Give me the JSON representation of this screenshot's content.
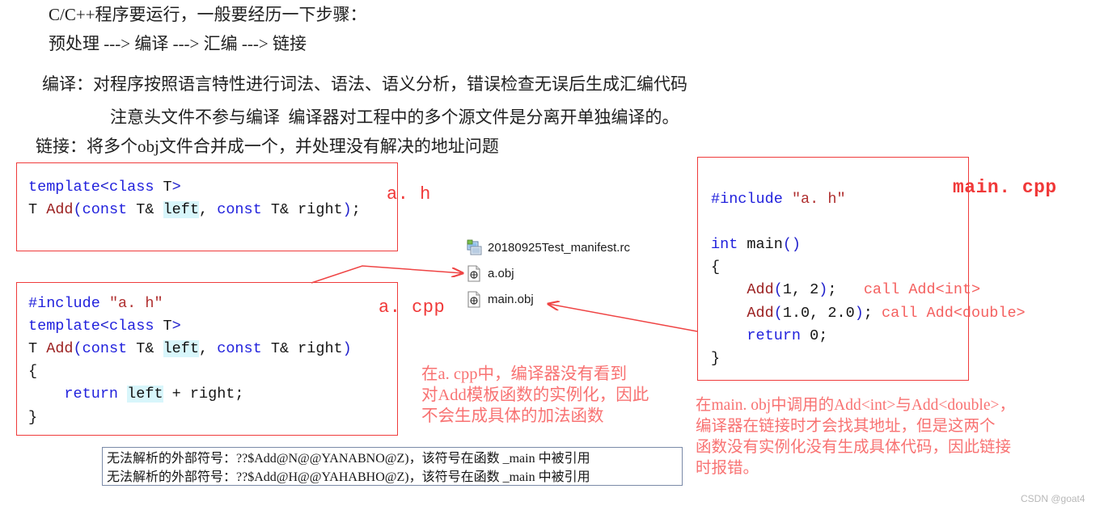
{
  "colors": {
    "box_border_red": "#ef3b3b",
    "annotation_red": "#f87272",
    "label_red": "#f03838",
    "keyword_blue": "#2222dd",
    "function_darkred": "#9b2020",
    "string_red": "#b03030",
    "highlight_cyan": "#d8f6fb",
    "error_box_border": "#7a8aa8",
    "background": "#ffffff"
  },
  "intro": {
    "line1": "C/C++程序要运行，一般要经历一下步骤：",
    "line2": "预处理 ---> 编译 ---> 汇编 ---> 链接",
    "line3": "编译：对程序按照语言特性进行词法、语法、语义分析，错误检查无误后生成汇编代码",
    "line4": "注意头文件不参与编译  编译器对工程中的多个源文件是分离开单独编译的。",
    "line5": "链接：将多个obj文件合并成一个，并处理没有解决的地址问题"
  },
  "boxes": {
    "a_h": {
      "label": "a. h",
      "lines": [
        [
          {
            "t": "template",
            "c": "kw"
          },
          {
            "t": "<",
            "c": "punc"
          },
          {
            "t": "class",
            "c": "kw"
          },
          {
            "t": " T",
            "c": "plain"
          },
          {
            "t": ">",
            "c": "punc"
          }
        ],
        [
          {
            "t": "T ",
            "c": "plain"
          },
          {
            "t": "Add",
            "c": "fn"
          },
          {
            "t": "(",
            "c": "punc"
          },
          {
            "t": "const",
            "c": "kw"
          },
          {
            "t": " T& ",
            "c": "plain"
          },
          {
            "t": "left",
            "c": "hl"
          },
          {
            "t": ", ",
            "c": "plain"
          },
          {
            "t": "const",
            "c": "kw"
          },
          {
            "t": " T& right",
            "c": "plain"
          },
          {
            "t": ")",
            "c": "punc"
          },
          {
            "t": ";",
            "c": "plain"
          }
        ]
      ]
    },
    "a_cpp": {
      "label": "a. cpp",
      "lines": [
        [
          {
            "t": "#include",
            "c": "kw"
          },
          {
            "t": " ",
            "c": "plain"
          },
          {
            "t": "\"a. h\"",
            "c": "str"
          }
        ],
        [
          {
            "t": "template",
            "c": "kw"
          },
          {
            "t": "<",
            "c": "punc"
          },
          {
            "t": "class",
            "c": "kw"
          },
          {
            "t": " T",
            "c": "plain"
          },
          {
            "t": ">",
            "c": "punc"
          }
        ],
        [
          {
            "t": "T ",
            "c": "plain"
          },
          {
            "t": "Add",
            "c": "fn"
          },
          {
            "t": "(",
            "c": "punc"
          },
          {
            "t": "const",
            "c": "kw"
          },
          {
            "t": " T& ",
            "c": "plain"
          },
          {
            "t": "left",
            "c": "hl"
          },
          {
            "t": ", ",
            "c": "plain"
          },
          {
            "t": "const",
            "c": "kw"
          },
          {
            "t": " T& right",
            "c": "plain"
          },
          {
            "t": ")",
            "c": "punc"
          }
        ],
        [
          {
            "t": "{",
            "c": "plain"
          }
        ],
        [
          {
            "t": "    ",
            "c": "plain"
          },
          {
            "t": "return",
            "c": "kw"
          },
          {
            "t": " ",
            "c": "plain"
          },
          {
            "t": "left",
            "c": "hl"
          },
          {
            "t": " + right;",
            "c": "plain"
          }
        ],
        [
          {
            "t": "}",
            "c": "plain"
          }
        ]
      ]
    },
    "main_cpp": {
      "label": "main. cpp",
      "lines": [
        [
          {
            "t": "#include",
            "c": "kw"
          },
          {
            "t": " ",
            "c": "plain"
          },
          {
            "t": "\"a. h\"",
            "c": "str"
          }
        ],
        [],
        [
          {
            "t": "int",
            "c": "kw"
          },
          {
            "t": " main",
            "c": "plain"
          },
          {
            "t": "()",
            "c": "punc"
          }
        ],
        [
          {
            "t": "{",
            "c": "plain"
          }
        ],
        [
          {
            "t": "    ",
            "c": "plain"
          },
          {
            "t": "Add",
            "c": "fn"
          },
          {
            "t": "(",
            "c": "punc"
          },
          {
            "t": "1",
            "c": "num"
          },
          {
            "t": ", ",
            "c": "plain"
          },
          {
            "t": "2",
            "c": "num"
          },
          {
            "t": ")",
            "c": "punc"
          },
          {
            "t": ";   ",
            "c": "plain"
          },
          {
            "t": "call Add<int>",
            "c": "cmt"
          }
        ],
        [
          {
            "t": "    ",
            "c": "plain"
          },
          {
            "t": "Add",
            "c": "fn"
          },
          {
            "t": "(",
            "c": "punc"
          },
          {
            "t": "1.0",
            "c": "num"
          },
          {
            "t": ", ",
            "c": "plain"
          },
          {
            "t": "2.0",
            "c": "num"
          },
          {
            "t": ")",
            "c": "punc"
          },
          {
            "t": "; ",
            "c": "plain"
          },
          {
            "t": "call Add<double>",
            "c": "cmt"
          }
        ],
        [
          {
            "t": "    ",
            "c": "plain"
          },
          {
            "t": "return",
            "c": "kw"
          },
          {
            "t": " ",
            "c": "plain"
          },
          {
            "t": "0",
            "c": "num"
          },
          {
            "t": ";",
            "c": "plain"
          }
        ],
        [
          {
            "t": "}",
            "c": "plain"
          }
        ]
      ]
    }
  },
  "filelist": [
    {
      "icon": "manifest-resource-icon",
      "name": "20180925Test_manifest.rc"
    },
    {
      "icon": "object-file-icon",
      "name": "a.obj"
    },
    {
      "icon": "object-file-icon",
      "name": "main.obj"
    }
  ],
  "annotations": {
    "middle": "在a. cpp中，编译器没有看到\n对Add模板函数的实例化，因此\n不会生成具体的加法函数",
    "right": "在main. obj中调用的Add<int>与Add<double>，\n编译器在链接时才会找其地址，但是这两个\n函数没有实例化没有生成具体代码，因此链接\n时报错。"
  },
  "errors": [
    "无法解析的外部符号：??$Add@N@@YANABNO@Z)，该符号在函数 _main 中被引用",
    "无法解析的外部符号：??$Add@H@@YAHABHO@Z)，该符号在函数 _main 中被引用"
  ],
  "watermark": "CSDN @goat4"
}
